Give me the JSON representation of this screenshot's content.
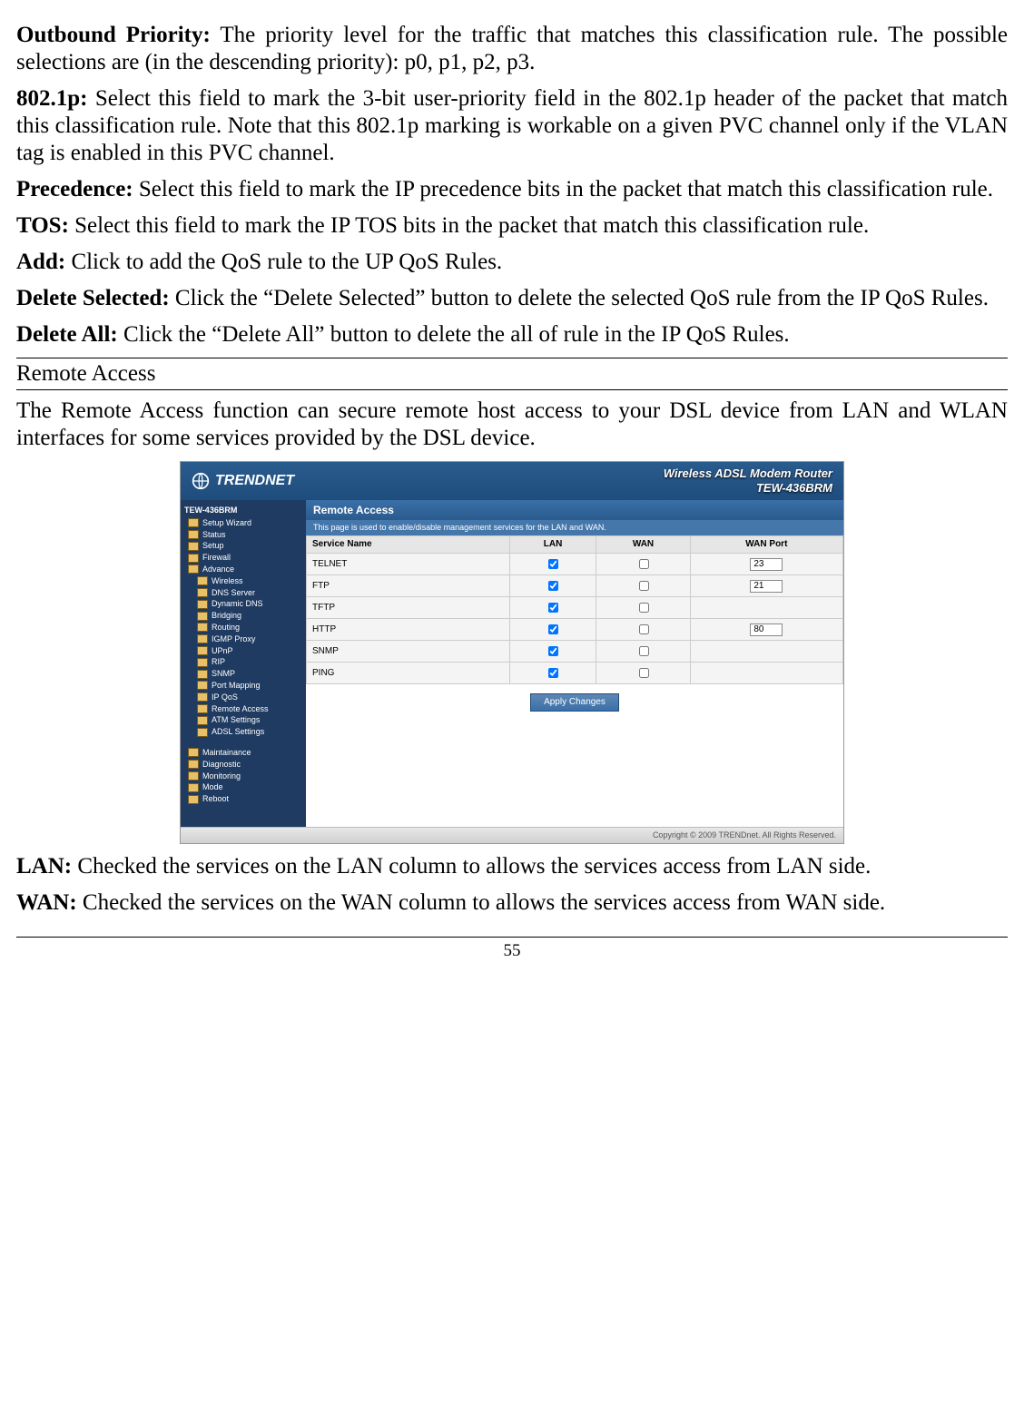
{
  "paras": {
    "p1": {
      "label": "Outbound  Priority:",
      "text": " The  priority  level  for  the  traffic  that  matches  this classification rule. The possible selections are (in the descending priority): p0, p1, p2, p3."
    },
    "p2": {
      "label": "802.1p:",
      "text": " Select this field to mark the 3-bit user-priority field in the 802.1p header of the  packet  that  match  this  classification  rule.  Note  that  this  802.1p  marking  is workable on  a  given PVC channel  only  if the VLAN tag  is enabled  in  this  PVC channel."
    },
    "p3": {
      "label": "Precedence:",
      "text": " Select  this  field  to  mark  the  IP  precedence  bits  in  the  packet  that match this classification rule."
    },
    "p4": {
      "label": "TOS:",
      "text": " Select  this  field  to  mark  the  IP  TOS  bits  in  the  packet  that  match  this classification rule."
    },
    "p5": {
      "label": "Add:",
      "text": " Click to add the QoS rule to the UP QoS Rules."
    },
    "p6": {
      "label": "Delete Selected:",
      "text": " Click the “Delete Selected” button to delete the selected QoS rule from the IP QoS Rules."
    },
    "p7": {
      "label": "Delete  All:",
      "text": " Click  the  “Delete  All”  button  to  delete  the  all  of  rule  in  the  IP  QoS Rules."
    },
    "p8": "The Remote Access  function  can  secure  remote  host  access  to  your  DSL  device from LAN and WLAN interfaces for some services provided by the DSL device.",
    "p9": {
      "label": "LAN:",
      "text": " Checked the services on the LAN column to allows the services access from LAN side."
    },
    "p10": {
      "label": "WAN:",
      "text": " Checked  the  services  on  the  WAN  column  to  allows  the  services  access from WAN side."
    }
  },
  "section_heading": "Remote Access",
  "page_number": "55",
  "screenshot": {
    "brand": "TRENDNET",
    "header_title_line1": "Wireless ADSL Modem Router",
    "header_title_line2": "TEW-436BRM",
    "sidebar": {
      "device": "TEW-436BRM",
      "top_items": [
        "Setup Wizard",
        "Status",
        "Setup",
        "Firewall"
      ],
      "advance_label": "Advance",
      "advance_items": [
        "Wireless",
        "DNS Server",
        "Dynamic DNS",
        "Bridging",
        "Routing",
        "IGMP Proxy",
        "UPnP",
        "RIP",
        "SNMP",
        "Port Mapping",
        "IP QoS",
        "Remote Access",
        "ATM Settings",
        "ADSL Settings"
      ],
      "bottom_items": [
        "Maintainance",
        "Diagnostic",
        "Monitoring",
        "Mode",
        "Reboot"
      ]
    },
    "panel": {
      "title": "Remote Access",
      "subtitle": "This page is used to enable/disable management services for the LAN and WAN.",
      "headers": [
        "Service Name",
        "LAN",
        "WAN",
        "WAN Port"
      ],
      "rows": [
        {
          "name": "TELNET",
          "lan": true,
          "wan": false,
          "port": "23"
        },
        {
          "name": "FTP",
          "lan": true,
          "wan": false,
          "port": "21"
        },
        {
          "name": "TFTP",
          "lan": true,
          "wan": false,
          "port": ""
        },
        {
          "name": "HTTP",
          "lan": true,
          "wan": false,
          "port": "80"
        },
        {
          "name": "SNMP",
          "lan": true,
          "wan": false,
          "port": ""
        },
        {
          "name": "PING",
          "lan": true,
          "wan": false,
          "port": ""
        }
      ],
      "apply_label": "Apply Changes"
    },
    "footer": "Copyright © 2009 TRENDnet. All Rights Reserved."
  }
}
